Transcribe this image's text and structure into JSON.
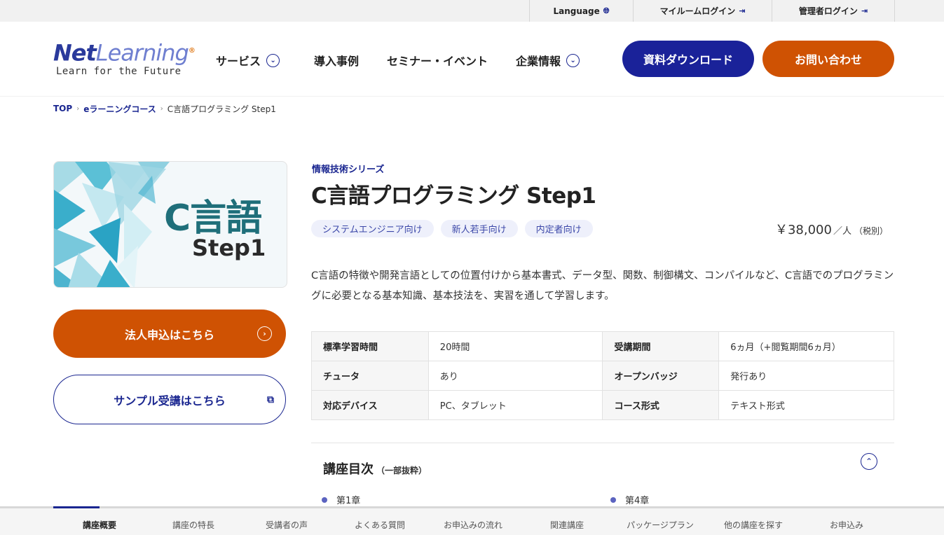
{
  "utility_bar": {
    "language": "Language",
    "myroom_login": "マイルームログイン",
    "admin_login": "管理者ログイン"
  },
  "header": {
    "logo_net": "Net",
    "logo_learning": "Learning",
    "logo_tagline": "Learn for the Future",
    "nav": {
      "service": "サービス",
      "cases": "導入事例",
      "seminar": "セミナー・イベント",
      "company": "企業情報"
    },
    "download_button": "資料ダウンロード",
    "contact_button": "お問い合わせ"
  },
  "breadcrumb": {
    "top": "TOP",
    "elearning": "eラーニングコース",
    "current": "C言語プログラミング Step1"
  },
  "thumbnail": {
    "title": "C言語",
    "subtitle": "Step1"
  },
  "cta": {
    "corporate": "法人申込はこちら",
    "sample": "サンプル受講はこちら"
  },
  "course": {
    "series": "情報技術シリーズ",
    "title": "C言語プログラミング Step1",
    "tags": [
      "システムエンジニア向け",
      "新人若手向け",
      "内定者向け"
    ],
    "price_amount": "￥38,000",
    "price_unit": "／人",
    "price_tax": "（税別）",
    "description": "C言語の特徴や開発言語としての位置付けから基本書式、データ型、関数、制御構文、コンパイルなど、C言語でのプログラミングに必要となる基本知識、基本技法を、実習を通して学習します。"
  },
  "spec": {
    "rows": [
      {
        "k1": "標準学習時間",
        "v1": "20時間",
        "k2": "受講期間",
        "v2": "6ヵ月（+閲覧期間6ヵ月）"
      },
      {
        "k1": "チュータ",
        "v1": "あり",
        "k2": "オープンバッジ",
        "v2": "発行あり"
      },
      {
        "k1": "対応デバイス",
        "v1": "PC、タブレット",
        "k2": "コース形式",
        "v2": "テキスト形式"
      }
    ]
  },
  "syllabus": {
    "title": "講座目次",
    "note": "（一部抜粋）",
    "chapters": [
      "第1章",
      "第4章"
    ]
  },
  "tabs": [
    "講座概要",
    "講座の特長",
    "受講者の声",
    "よくある質問",
    "お申込みの流れ",
    "関連講座",
    "パッケージプラン",
    "他の講座を探す",
    "お申込み"
  ],
  "colors": {
    "navy": "#1a2299",
    "orange": "#cf5203",
    "tag_bg": "#eef0fb"
  }
}
